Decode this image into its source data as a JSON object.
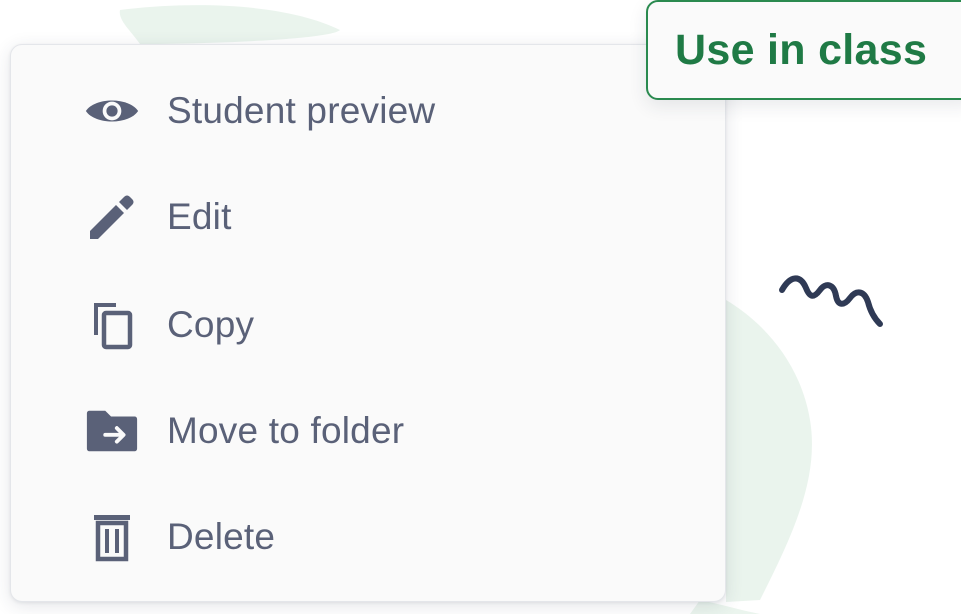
{
  "button": {
    "use_in_class_label": "Use in class"
  },
  "menu": {
    "items": [
      {
        "label": "Student preview",
        "icon": "eye-icon"
      },
      {
        "label": "Edit",
        "icon": "pencil-icon"
      },
      {
        "label": "Copy",
        "icon": "copy-icon"
      },
      {
        "label": "Move to folder",
        "icon": "folder-move-icon"
      },
      {
        "label": "Delete",
        "icon": "trash-icon"
      }
    ]
  },
  "colors": {
    "accent_green": "#1f7a45",
    "menu_text": "#5a6178",
    "menu_background": "#fafafa"
  }
}
